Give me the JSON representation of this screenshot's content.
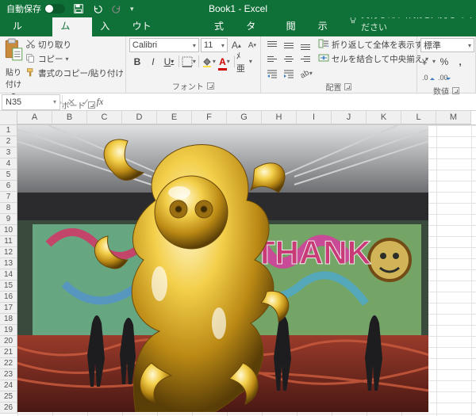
{
  "titlebar": {
    "autosave_label": "自動保存",
    "autosave_on": false,
    "book_title": "Book1 - Excel"
  },
  "tabs": {
    "file": "ファイル",
    "home": "ホーム",
    "insert": "挿入",
    "pagelayout": "ページ レイアウト",
    "formulas": "数式",
    "data": "データ",
    "review": "校閲",
    "view": "表示",
    "tellme_placeholder": "実行したい作業を入力してください",
    "active": "home"
  },
  "ribbon": {
    "clipboard": {
      "paste": "貼り付け",
      "cut": "切り取り",
      "copy": "コピー",
      "format_painter": "書式のコピー/貼り付け",
      "group_label": "クリップボード"
    },
    "font": {
      "name": "Calibri",
      "size": "11",
      "group_label": "フォント"
    },
    "alignment": {
      "wrap": "折り返して全体を表示する",
      "merge": "セルを結合して中央揃え",
      "group_label": "配置"
    },
    "number": {
      "format": "標準",
      "group_label": "数値"
    }
  },
  "formula_bar": {
    "name_box": "N35",
    "formula": ""
  },
  "grid": {
    "columns": [
      "A",
      "B",
      "C",
      "D",
      "E",
      "F",
      "G",
      "H",
      "I",
      "J",
      "K",
      "L",
      "M"
    ],
    "rows": [
      "1",
      "2",
      "3",
      "4",
      "5",
      "6",
      "7",
      "8",
      "9",
      "10",
      "11",
      "12",
      "13",
      "14",
      "15",
      "16",
      "17",
      "18",
      "19",
      "20",
      "21",
      "22",
      "23",
      "24",
      "25",
      "26"
    ]
  }
}
